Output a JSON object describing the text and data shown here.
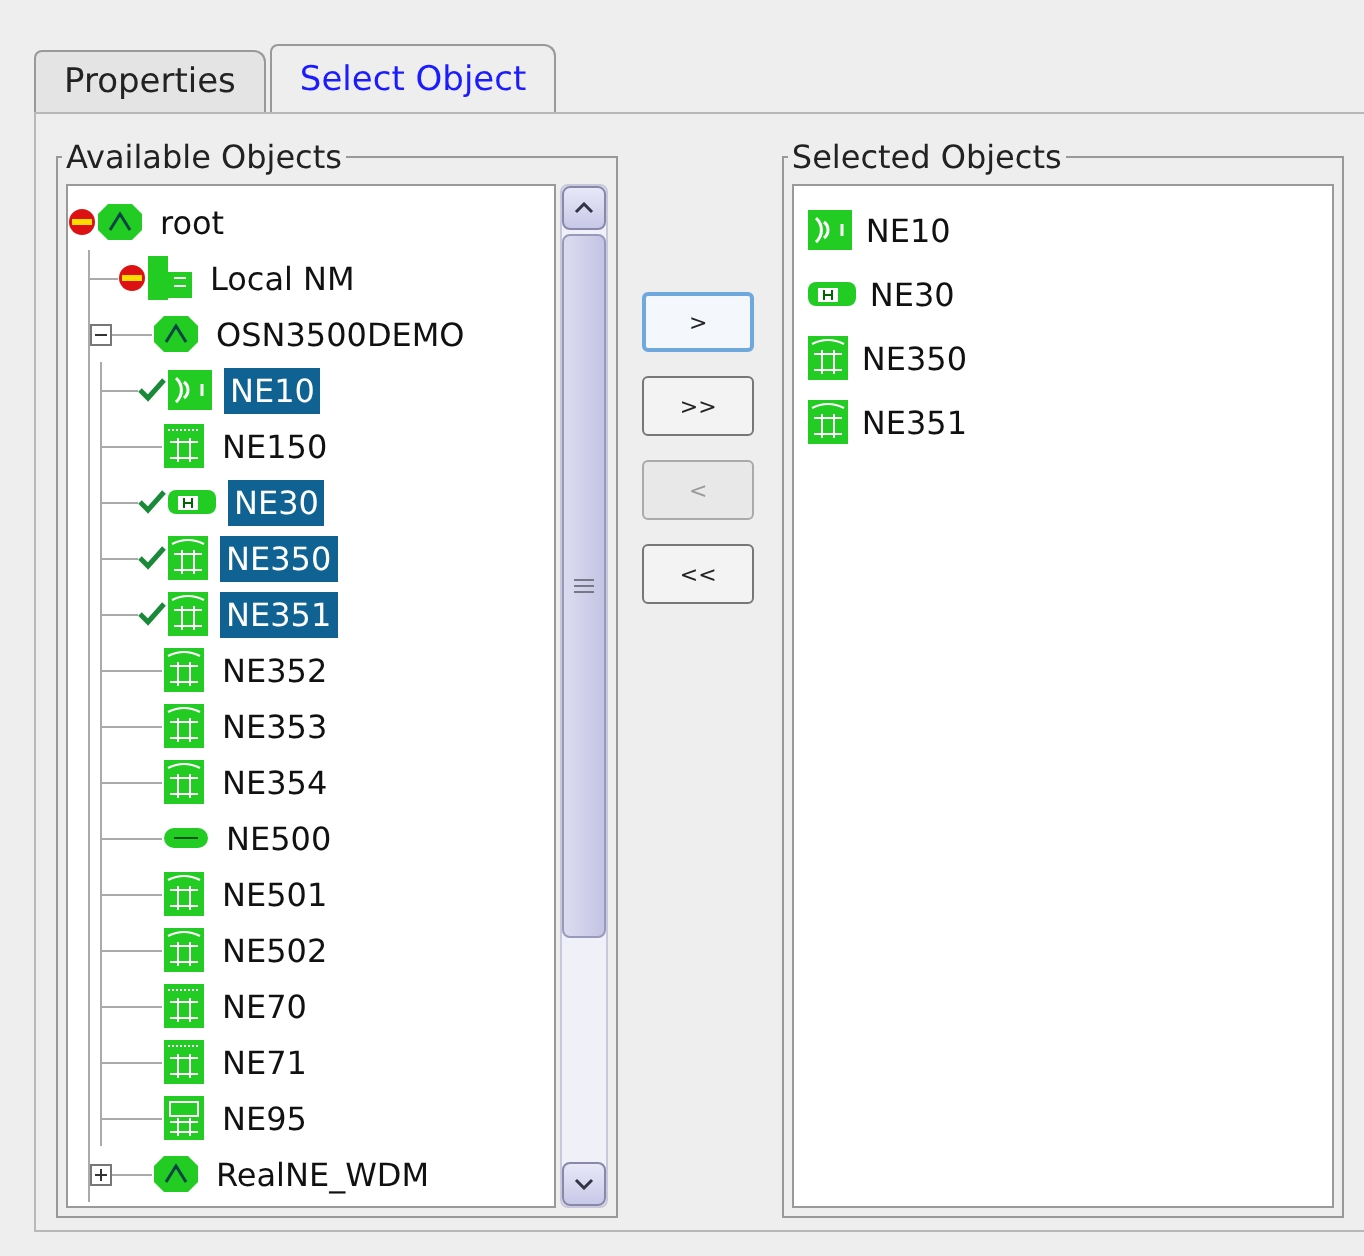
{
  "tabs": [
    {
      "label": "Properties",
      "selected": false
    },
    {
      "label": "Select Object",
      "selected": true
    }
  ],
  "available": {
    "title": "Available Objects",
    "tree": [
      {
        "label": "root",
        "kind": "network",
        "alarm": true,
        "checked": false,
        "selected": false,
        "expanded": true,
        "children": [
          {
            "label": "Local NM",
            "kind": "nm",
            "alarm": true,
            "checked": false,
            "selected": false
          },
          {
            "label": "OSN3500DEMO",
            "kind": "network",
            "alarm": false,
            "checked": false,
            "selected": false,
            "expanded": true,
            "children": [
              {
                "label": "NE10",
                "kind": "wdm",
                "alarm": false,
                "checked": true,
                "selected": true
              },
              {
                "label": "NE150",
                "kind": "sdh",
                "alarm": false,
                "checked": false,
                "selected": false
              },
              {
                "label": "NE30",
                "kind": "hub",
                "alarm": false,
                "checked": true,
                "selected": true
              },
              {
                "label": "NE350",
                "kind": "adm",
                "alarm": false,
                "checked": true,
                "selected": true
              },
              {
                "label": "NE351",
                "kind": "adm",
                "alarm": false,
                "checked": true,
                "selected": true
              },
              {
                "label": "NE352",
                "kind": "adm",
                "alarm": false,
                "checked": false,
                "selected": false
              },
              {
                "label": "NE353",
                "kind": "adm",
                "alarm": false,
                "checked": false,
                "selected": false
              },
              {
                "label": "NE354",
                "kind": "adm",
                "alarm": false,
                "checked": false,
                "selected": false
              },
              {
                "label": "NE500",
                "kind": "bar",
                "alarm": false,
                "checked": false,
                "selected": false
              },
              {
                "label": "NE501",
                "kind": "adm",
                "alarm": false,
                "checked": false,
                "selected": false
              },
              {
                "label": "NE502",
                "kind": "adm",
                "alarm": false,
                "checked": false,
                "selected": false
              },
              {
                "label": "NE70",
                "kind": "sdh",
                "alarm": false,
                "checked": false,
                "selected": false
              },
              {
                "label": "NE71",
                "kind": "sdh",
                "alarm": false,
                "checked": false,
                "selected": false
              },
              {
                "label": "NE95",
                "kind": "matrix",
                "alarm": false,
                "checked": false,
                "selected": false
              }
            ]
          },
          {
            "label": "RealNE_WDM",
            "kind": "network",
            "alarm": false,
            "checked": false,
            "selected": false,
            "expanded": false
          }
        ]
      }
    ]
  },
  "buttons": [
    {
      "label": ">",
      "disabled": false,
      "focused": true
    },
    {
      "label": ">>",
      "disabled": false,
      "focused": false
    },
    {
      "label": "<",
      "disabled": true,
      "focused": false
    },
    {
      "label": "<<",
      "disabled": false,
      "focused": false
    }
  ],
  "selected_objects": {
    "title": "Selected Objects",
    "items": [
      {
        "label": "NE10",
        "kind": "wdm"
      },
      {
        "label": "NE30",
        "kind": "hub"
      },
      {
        "label": "NE350",
        "kind": "adm"
      },
      {
        "label": "NE351",
        "kind": "adm"
      }
    ]
  }
}
